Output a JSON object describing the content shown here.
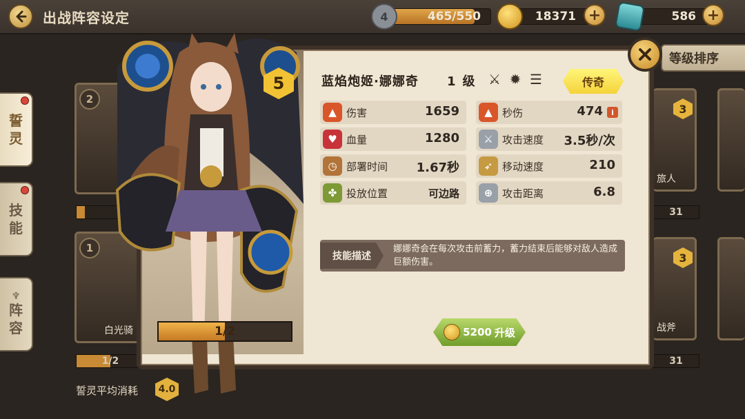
{
  "header": {
    "title": "出战阵容设定",
    "stamina": {
      "icon_text": "4",
      "value": "465/550",
      "fill_fraction": 0.845
    },
    "gold": {
      "value": "18371"
    },
    "gems": {
      "value": "586"
    },
    "plus": "+"
  },
  "nav": {
    "tabs": [
      {
        "label_top": "誓",
        "label_bottom": "灵"
      },
      {
        "label_top": "技",
        "label_bottom": "能"
      },
      {
        "label_top": "阵",
        "label_bottom": "容"
      }
    ]
  },
  "roster": {
    "sort_label": "等级排序",
    "cards": [
      {
        "level": "2",
        "name": ""
      },
      {
        "level": "1",
        "name": "白光骑",
        "bar": "1/2"
      },
      {
        "level": "3",
        "name": "旅人",
        "bar": "31"
      },
      {
        "level": "3",
        "name": "战斧",
        "bar": "31"
      }
    ],
    "avg_label": "誓灵平均消耗",
    "avg_value": "4.0"
  },
  "hero": {
    "star": "5",
    "name": "蓝焰炮姬·娜娜奇",
    "level": "1",
    "level_unit": "级",
    "rarity": "传奇",
    "shards": "1/2",
    "shard_fraction": 0.5,
    "stats_left": [
      {
        "icon": "fire-icon",
        "label": "伤害",
        "value": "1659",
        "color": "#d9562a"
      },
      {
        "icon": "heart-icon",
        "label": "血量",
        "value": "1280",
        "color": "#c8333a"
      },
      {
        "icon": "stopwatch-icon",
        "label": "部署时间",
        "value": "1.67秒",
        "color": "#b3743a"
      },
      {
        "icon": "placement-icon",
        "label": "投放位置",
        "value": "可边路",
        "color": "#7d9a36"
      }
    ],
    "stats_right": [
      {
        "icon": "fire-icon",
        "label": "秒伤",
        "value": "474",
        "color": "#d9562a"
      },
      {
        "icon": "sword-speed-icon",
        "label": "攻击速度",
        "value": "3.5秒/次",
        "color": "#9aa0a8"
      },
      {
        "icon": "wing-icon",
        "label": "移动速度",
        "value": "210",
        "color": "#c69a43"
      },
      {
        "icon": "target-sword-icon",
        "label": "攻击距离",
        "value": "6.8",
        "color": "#9aa0a8"
      }
    ],
    "skill_tag": "技能描述",
    "skill_desc": "娜娜奇会在每次攻击前蓄力，蓄力结束后能够对敌人造成巨额伤害。",
    "upgrade_cost": "5200",
    "upgrade_label": "升级"
  }
}
